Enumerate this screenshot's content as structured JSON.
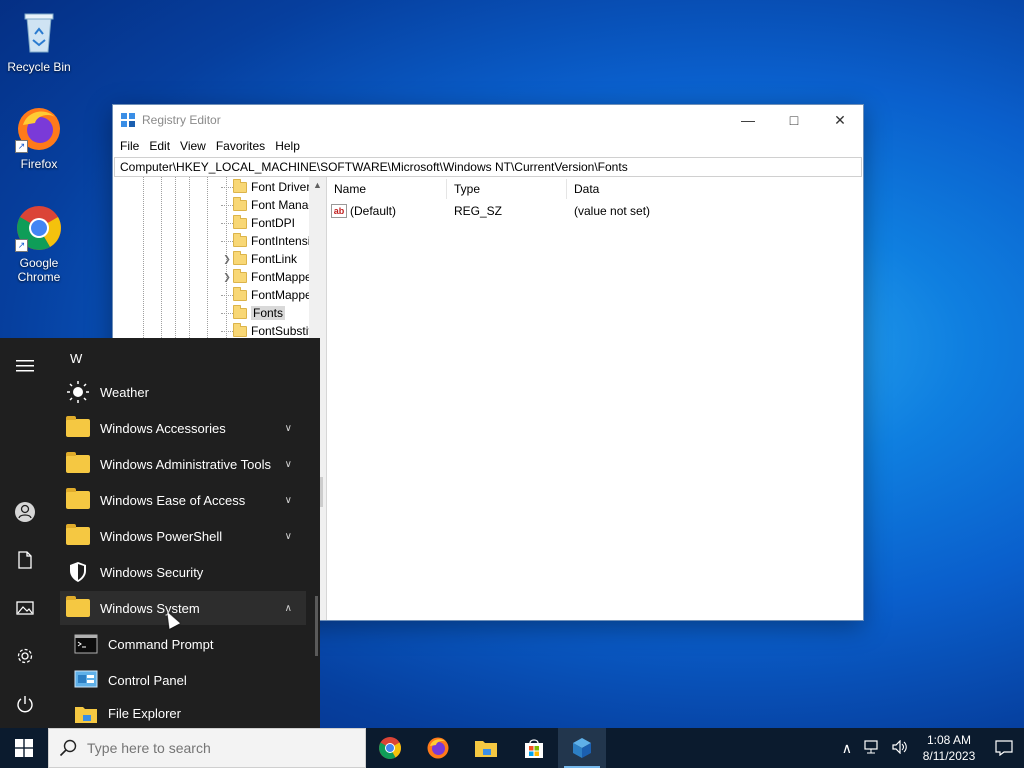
{
  "desktop": {
    "icons": [
      {
        "label": "Recycle Bin",
        "icon": "recycle-bin-icon"
      },
      {
        "label": "Firefox",
        "icon": "firefox-icon"
      },
      {
        "label": "Google Chrome",
        "icon": "chrome-icon"
      }
    ]
  },
  "regedit": {
    "title": "Registry Editor",
    "menu": [
      "File",
      "Edit",
      "View",
      "Favorites",
      "Help"
    ],
    "address": "Computer\\HKEY_LOCAL_MACHINE\\SOFTWARE\\Microsoft\\Windows NT\\CurrentVersion\\Fonts",
    "tree": [
      {
        "label": "Font Driver",
        "expandable": false
      },
      {
        "label": "Font Manag",
        "expandable": false
      },
      {
        "label": "FontDPI",
        "expandable": false
      },
      {
        "label": "FontIntensi",
        "expandable": false
      },
      {
        "label": "FontLink",
        "expandable": true
      },
      {
        "label": "FontMappe",
        "expandable": true
      },
      {
        "label": "FontMappe",
        "expandable": false
      },
      {
        "label": "Fonts",
        "expandable": false,
        "selected": true
      },
      {
        "label": "FontSubstit",
        "expandable": false
      }
    ],
    "columns": [
      "Name",
      "Type",
      "Data"
    ],
    "values": [
      {
        "name": "(Default)",
        "type": "REG_SZ",
        "data": "(value not set)"
      }
    ]
  },
  "start_menu": {
    "letter": "W",
    "items": [
      {
        "label": "Weather",
        "icon": "weather-sun-icon",
        "expandable": false
      },
      {
        "label": "Windows Accessories",
        "icon": "folder-icon",
        "expandable": true
      },
      {
        "label": "Windows Administrative Tools",
        "icon": "folder-icon",
        "expandable": true
      },
      {
        "label": "Windows Ease of Access",
        "icon": "folder-icon",
        "expandable": true
      },
      {
        "label": "Windows PowerShell",
        "icon": "folder-icon",
        "expandable": true
      },
      {
        "label": "Windows Security",
        "icon": "shield-icon",
        "expandable": false
      },
      {
        "label": "Windows System",
        "icon": "folder-icon",
        "expandable": true,
        "expanded": true
      },
      {
        "label": "Command Prompt",
        "icon": "cmd-icon",
        "sub": true
      },
      {
        "label": "Control Panel",
        "icon": "control-panel-icon",
        "sub": true
      },
      {
        "label": "File Explorer",
        "icon": "file-explorer-icon",
        "sub": true
      }
    ],
    "rail": [
      "hamburger-icon",
      "user-icon",
      "documents-icon",
      "pictures-icon",
      "settings-icon",
      "power-icon"
    ]
  },
  "taskbar": {
    "search_placeholder": "Type here to search",
    "apps": [
      "chrome-icon",
      "firefox-icon",
      "file-explorer-icon",
      "store-icon",
      "regedit-icon"
    ],
    "time": "1:08 AM",
    "date": "8/11/2023"
  }
}
